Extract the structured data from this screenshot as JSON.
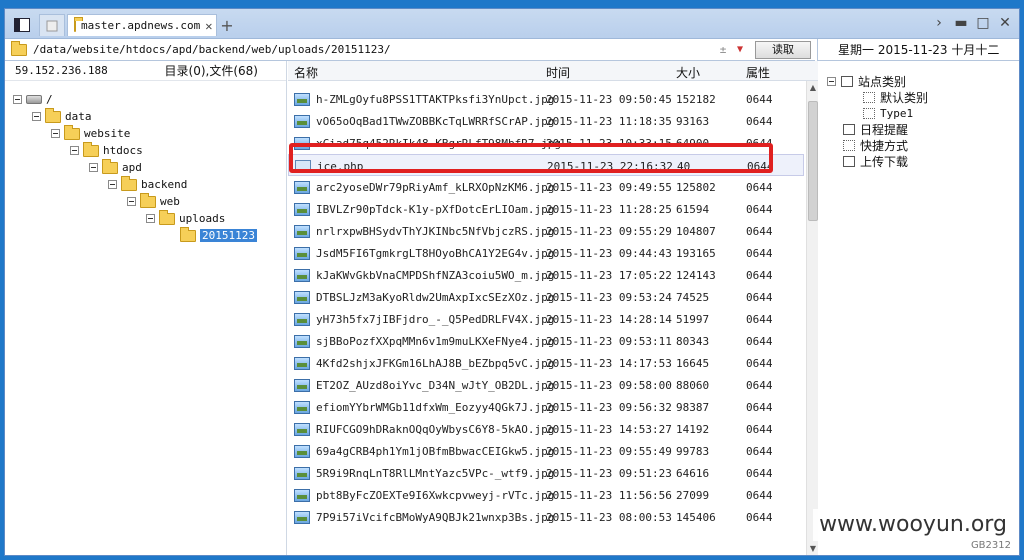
{
  "tabs": {
    "active_title": "master.apdnews.com"
  },
  "address": {
    "path": "/data/website/htdocs/apd/backend/web/uploads/20151123/",
    "read_button": "读取"
  },
  "date": "星期一  2015-11-23  十月十二",
  "left": {
    "ip": "59.152.236.188",
    "counts": "目录(0),文件(68)",
    "tree": [
      "/",
      "data",
      "website",
      "htdocs",
      "apd",
      "backend",
      "web",
      "uploads",
      "20151123"
    ]
  },
  "columns": {
    "name": "名称",
    "time": "时间",
    "size": "大小",
    "attr": "属性"
  },
  "files": [
    {
      "name": "h-ZMLgOyfu8PSS1TTAKTPksfi3YnUpct.jpg",
      "time": "2015-11-23 09:50:45",
      "size": "152182",
      "attr": "0644"
    },
    {
      "name": "vO65oOqBad1TWwZOBBKcTqLWRRfSCrAP.jpg",
      "time": "2015-11-23 11:18:35",
      "size": "93163",
      "attr": "0644"
    },
    {
      "name": "xCiad75q452RkIk48-KBgrRLfT98MbfR7.jpg",
      "time": "2015-11-23 10:33:15",
      "size": "64900",
      "attr": "0644"
    },
    {
      "name": "ice.php",
      "time": "2015-11-23 22:16:32",
      "size": "40",
      "attr": "0644"
    },
    {
      "name": "arc2yoseDWr79pRiyAmf_kLRXOpNzKM6.jpg",
      "time": "2015-11-23 09:49:55",
      "size": "125802",
      "attr": "0644"
    },
    {
      "name": "IBVLZr90pTdck-K1y-pXfDotcErLIOam.jpg",
      "time": "2015-11-23 11:28:25",
      "size": "61594",
      "attr": "0644"
    },
    {
      "name": "nrlrxpwBHSydvThYJKINbc5NfVbjczRS.jpg",
      "time": "2015-11-23 09:55:29",
      "size": "104807",
      "attr": "0644"
    },
    {
      "name": "JsdM5FI6TgmkrgLT8HOyoBhCA1Y2EG4v.jpg",
      "time": "2015-11-23 09:44:43",
      "size": "193165",
      "attr": "0644"
    },
    {
      "name": "kJaKWvGkbVnaCMPDShfNZA3coiu5WO_m.jpg",
      "time": "2015-11-23 17:05:22",
      "size": "124143",
      "attr": "0644"
    },
    {
      "name": "DTBSLJzM3aKyoRldw2UmAxpIxcSEzXOz.jpg",
      "time": "2015-11-23 09:53:24",
      "size": "74525",
      "attr": "0644"
    },
    {
      "name": "yH73h5fx7jIBFjdro_-_Q5PedDRLFV4X.jpg",
      "time": "2015-11-23 14:28:14",
      "size": "51997",
      "attr": "0644"
    },
    {
      "name": "sjBBoPozfXXpqMMn6v1m9muLKXeFNye4.jpg",
      "time": "2015-11-23 09:53:11",
      "size": "80343",
      "attr": "0644"
    },
    {
      "name": "4Kfd2shjxJFKGm16LhAJ8B_bEZbpq5vC.jpg",
      "time": "2015-11-23 14:17:53",
      "size": "16645",
      "attr": "0644"
    },
    {
      "name": "ET2OZ_AUzd8oiYvc_D34N_wJtY_OB2DL.jpg",
      "time": "2015-11-23 09:58:00",
      "size": "88060",
      "attr": "0644"
    },
    {
      "name": "efiomYYbrWMGb11dfxWm_Eozyy4QGk7J.jpg",
      "time": "2015-11-23 09:56:32",
      "size": "98387",
      "attr": "0644"
    },
    {
      "name": "RIUFCGO9hDRaknOQqOyWbysC6Y8-5kAO.jpg",
      "time": "2015-11-23 14:53:27",
      "size": "14192",
      "attr": "0644"
    },
    {
      "name": "69a4gCRB4ph1Ym1jOBfmBbwacCEIGkw5.jpg",
      "time": "2015-11-23 09:55:49",
      "size": "99783",
      "attr": "0644"
    },
    {
      "name": "5R9i9RnqLnT8RlLMntYazc5VPc-_wtf9.jpg",
      "time": "2015-11-23 09:51:23",
      "size": "64616",
      "attr": "0644"
    },
    {
      "name": "pbt8ByFcZOEXTe9I6Xwkcpvweyj-rVTc.jpg",
      "time": "2015-11-23 11:56:56",
      "size": "27099",
      "attr": "0644"
    },
    {
      "name": "7P9i57iVcifcBMoWyA9QBJk21wnxp3Bs.jpg",
      "time": "2015-11-23 08:00:53",
      "size": "145406",
      "attr": "0644"
    }
  ],
  "right_panel": [
    "站点类别",
    "默认类别",
    "Type1",
    "日程提醒",
    "快捷方式",
    "上传下载"
  ],
  "watermark": "www.wooyun.org",
  "watermark_small": "GB2312"
}
